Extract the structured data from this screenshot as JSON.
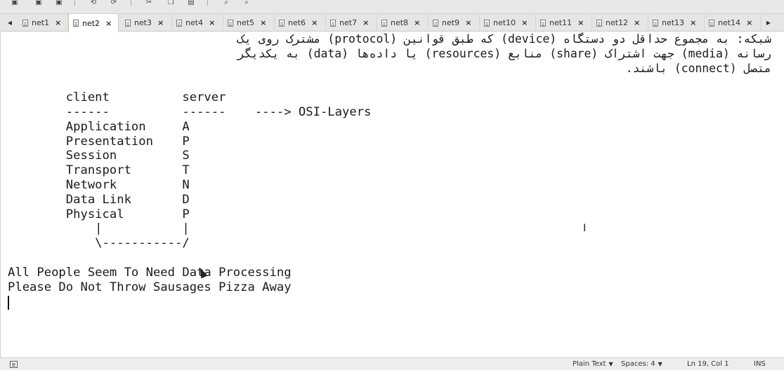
{
  "toolbar": {
    "icons": [
      "open-icon",
      "save-all-icon",
      "save-icon",
      "undo-icon",
      "redo-icon",
      "cut-icon",
      "copy-icon",
      "paste-icon",
      "search-icon",
      "replace-icon"
    ]
  },
  "tabs": [
    {
      "label": "net1",
      "active": false
    },
    {
      "label": "net2",
      "active": true
    },
    {
      "label": "net3",
      "active": false
    },
    {
      "label": "net4",
      "active": false
    },
    {
      "label": "net5",
      "active": false
    },
    {
      "label": "net6",
      "active": false
    },
    {
      "label": "net7",
      "active": false
    },
    {
      "label": "net8",
      "active": false
    },
    {
      "label": "net9",
      "active": false
    },
    {
      "label": "net10",
      "active": false
    },
    {
      "label": "net11",
      "active": false
    },
    {
      "label": "net12",
      "active": false
    },
    {
      "label": "net13",
      "active": false
    },
    {
      "label": "net14",
      "active": false
    }
  ],
  "tab_close_glyph": "×",
  "editor": {
    "persian_lines": [
      "شبکه: به مجموع حداقل دو دستگاه (device) که طبق قوانین (protocol) مشترک روی یک",
      "رسانه (media) جهت اشتراک (share) منابع (resources) یا داده‌ها (data) به یکدیگر",
      "متصل (connect) باشند."
    ],
    "lines": [
      "        client          server",
      "        ------          ------    ----> OSI-Layers",
      "        Application     A",
      "        Presentation    P",
      "        Session         S",
      "        Transport       T",
      "        Network         N",
      "        Data Link       D",
      "        Physical        P",
      "            |           |",
      "            \\-----------/",
      "",
      "All People Seem To Need Data Processing",
      "Please Do Not Throw Sausages Pizza Away"
    ]
  },
  "statusbar": {
    "language": "Plain Text",
    "spaces": "Spaces: 4",
    "position": "Ln 19, Col 1",
    "mode": "INS"
  }
}
